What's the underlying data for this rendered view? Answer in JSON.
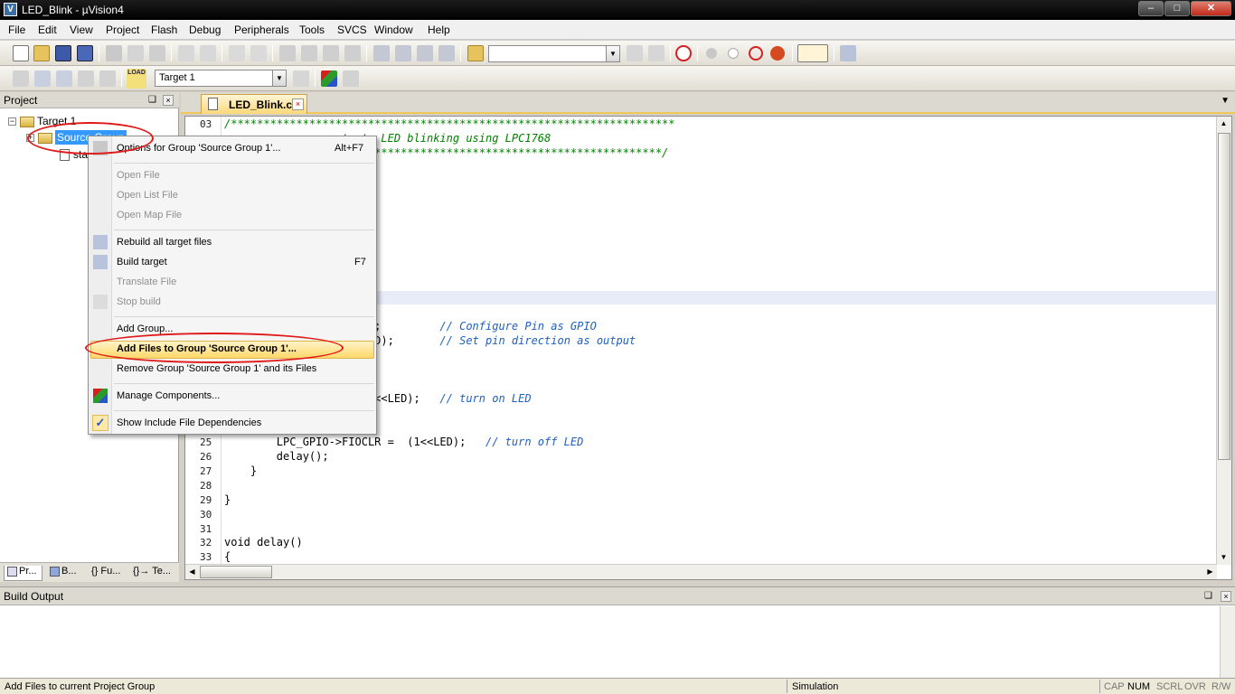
{
  "window": {
    "title": "LED_Blink  - µVision4",
    "app_icon_glyph": "V",
    "controls": {
      "minimize": "–",
      "maximize": "□",
      "close": "✕"
    }
  },
  "menubar": {
    "items": [
      "File",
      "Edit",
      "View",
      "Project",
      "Flash",
      "Debug",
      "Peripherals",
      "Tools",
      "SVCS",
      "Window",
      "Help"
    ]
  },
  "toolbar1": {
    "search_combo_value": "",
    "icons": [
      "new-file-icon",
      "open-file-icon",
      "save-icon",
      "save-all-icon",
      "cut-icon",
      "copy-icon",
      "paste-icon",
      "undo-icon",
      "redo-icon",
      "navigate-back-icon",
      "navigate-forward-icon",
      "bookmark-icon",
      "bookmark-prev-icon",
      "bookmark-next-icon",
      "bookmark-clear-icon",
      "indent-icon",
      "unindent-icon",
      "comment-icon",
      "uncomment-icon",
      "find-in-files-icon",
      "find-icon",
      "incremental-find-icon",
      "debug-session-icon",
      "breakpoint-icon",
      "disable-breakpoint-icon",
      "disable-all-breakpoints-icon",
      "kill-breakpoints-icon",
      "window-layout-icon",
      "configure-icon"
    ]
  },
  "toolbar2": {
    "target_combo_value": "Target 1",
    "load_label": "LOAD",
    "icons": [
      "translate-icon",
      "build-icon",
      "rebuild-icon",
      "batch-build-icon",
      "stop-build-icon",
      "download-icon",
      "target-options-icon",
      "manage-components-icon",
      "select-packs-icon"
    ]
  },
  "project_panel": {
    "title": "Project",
    "pin_glyph": "❑",
    "close_glyph": "×",
    "tree": {
      "target": "Target 1",
      "group": "Source Group",
      "file_prefix": "sta",
      "expander_minus": "−",
      "expander_plus": "+"
    },
    "tabs": [
      {
        "label": "Pr..."
      },
      {
        "label": "B..."
      },
      {
        "label": "{} Fu..."
      },
      {
        "label": "{}→ Te..."
      }
    ]
  },
  "editor": {
    "open_tab": "LED_Blink.c",
    "tab_close_glyph": "×",
    "tab_menu_glyph": "▼",
    "scroll_glyphs": {
      "up": "▲",
      "down": "▼",
      "left": "◀",
      "right": "▶"
    },
    "lines": [
      {
        "no": "03",
        "code": "/********************************************************************",
        "comment": ""
      },
      {
        "no": "",
        "code": "       ",
        "comment": "          strate LED blinking using LPC1768"
      },
      {
        "no": "",
        "code": "",
        "comment": "        ***********************************************************/"
      },
      {
        "no": "",
        "code": "              L0 = 0x00;         ",
        "comment": "// Configure Pin as GPIO"
      },
      {
        "no": "",
        "code": "               = (1<<LED);       ",
        "comment": "// Set pin direction as output"
      },
      {
        "no": "",
        "code": "              SET =  (1<<LED);   ",
        "comment": "// turn on LED"
      },
      {
        "no": "25",
        "code": "        LPC_GPIO->FIOCLR =  (1<<LED);   ",
        "comment": "// turn off LED"
      },
      {
        "no": "26",
        "code": "        delay();",
        "comment": ""
      },
      {
        "no": "27",
        "code": "    }",
        "comment": ""
      },
      {
        "no": "28",
        "code": "",
        "comment": ""
      },
      {
        "no": "29",
        "code": "}",
        "comment": ""
      },
      {
        "no": "30",
        "code": "",
        "comment": ""
      },
      {
        "no": "31",
        "code": "",
        "comment": ""
      },
      {
        "no": "32",
        "code": "void delay()",
        "comment": ""
      },
      {
        "no": "33",
        "code": "{",
        "comment": ""
      }
    ]
  },
  "context_menu": {
    "items": [
      {
        "label": "Options for Group 'Source Group 1'...",
        "shortcut": "Alt+F7",
        "enabled": true,
        "icon": "options-icon"
      },
      {
        "label": "Open File",
        "shortcut": "",
        "enabled": false
      },
      {
        "label": "Open List File",
        "shortcut": "",
        "enabled": false
      },
      {
        "label": "Open Map File",
        "shortcut": "",
        "enabled": false
      },
      {
        "label": "Rebuild all target files",
        "shortcut": "",
        "enabled": true,
        "icon": "rebuild-icon"
      },
      {
        "label": "Build target",
        "shortcut": "F7",
        "enabled": true,
        "icon": "build-icon"
      },
      {
        "label": "Translate File",
        "shortcut": "",
        "enabled": false
      },
      {
        "label": "Stop build",
        "shortcut": "",
        "enabled": false,
        "icon": "stop-build-icon"
      },
      {
        "label": "Add Group...",
        "shortcut": "",
        "enabled": true
      },
      {
        "label": "Add Files to Group 'Source Group 1'...",
        "shortcut": "",
        "enabled": true,
        "highlighted": true
      },
      {
        "label": "Remove Group 'Source Group 1' and its Files",
        "shortcut": "",
        "enabled": true
      },
      {
        "label": "Manage Components...",
        "shortcut": "",
        "enabled": true,
        "icon": "manage-components-icon"
      },
      {
        "label": "Show Include File Dependencies",
        "shortcut": "",
        "enabled": true,
        "checked": true
      }
    ],
    "check_glyph": "✓"
  },
  "build_output": {
    "title": "Build Output",
    "pin_glyph": "❑",
    "close_glyph": "×"
  },
  "statusbar": {
    "message": "Add Files to current Project Group",
    "mode": "Simulation",
    "indicators": [
      "CAP",
      "NUM",
      "SCRL",
      "OVR",
      "R/W"
    ]
  },
  "colors": {
    "annotation": "#e01919",
    "highlight": "#ffd86a",
    "selection": "#3399ff"
  }
}
